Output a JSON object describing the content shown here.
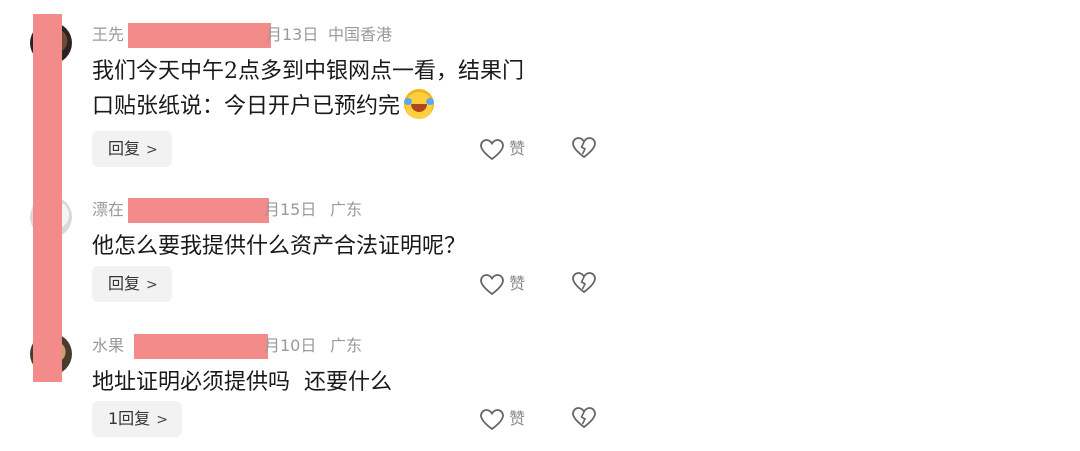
{
  "comments": [
    {
      "author": "王先",
      "date": "月13日",
      "location": "中国香港",
      "lines": [
        "我们今天中午2点多到中银网点一看，结果门",
        "口贴张纸说：今日开户已预约完"
      ],
      "reply_label": "回复",
      "like_label": "赞"
    },
    {
      "author": "漂在",
      "date": "月15日",
      "location": "广东",
      "lines": [
        "他怎么要我提供什么资产合法证明呢？"
      ],
      "reply_label": "回复",
      "like_label": "赞"
    },
    {
      "author": "水果",
      "date": "月10日",
      "location": "广东",
      "lines": [
        "地址证明必须提供吗  还要什么"
      ],
      "reply_label": "1回复",
      "like_label": "赞"
    }
  ],
  "colors": {
    "redaction": "#f38b8b",
    "meta_text": "#9a9a9a",
    "reply_bg": "#f2f2f2"
  },
  "icons": {
    "like": "heart-icon",
    "dislike": "broken-heart-icon",
    "emoji": "laughing-crying-emoji",
    "chevron": "chevron-right-icon"
  }
}
